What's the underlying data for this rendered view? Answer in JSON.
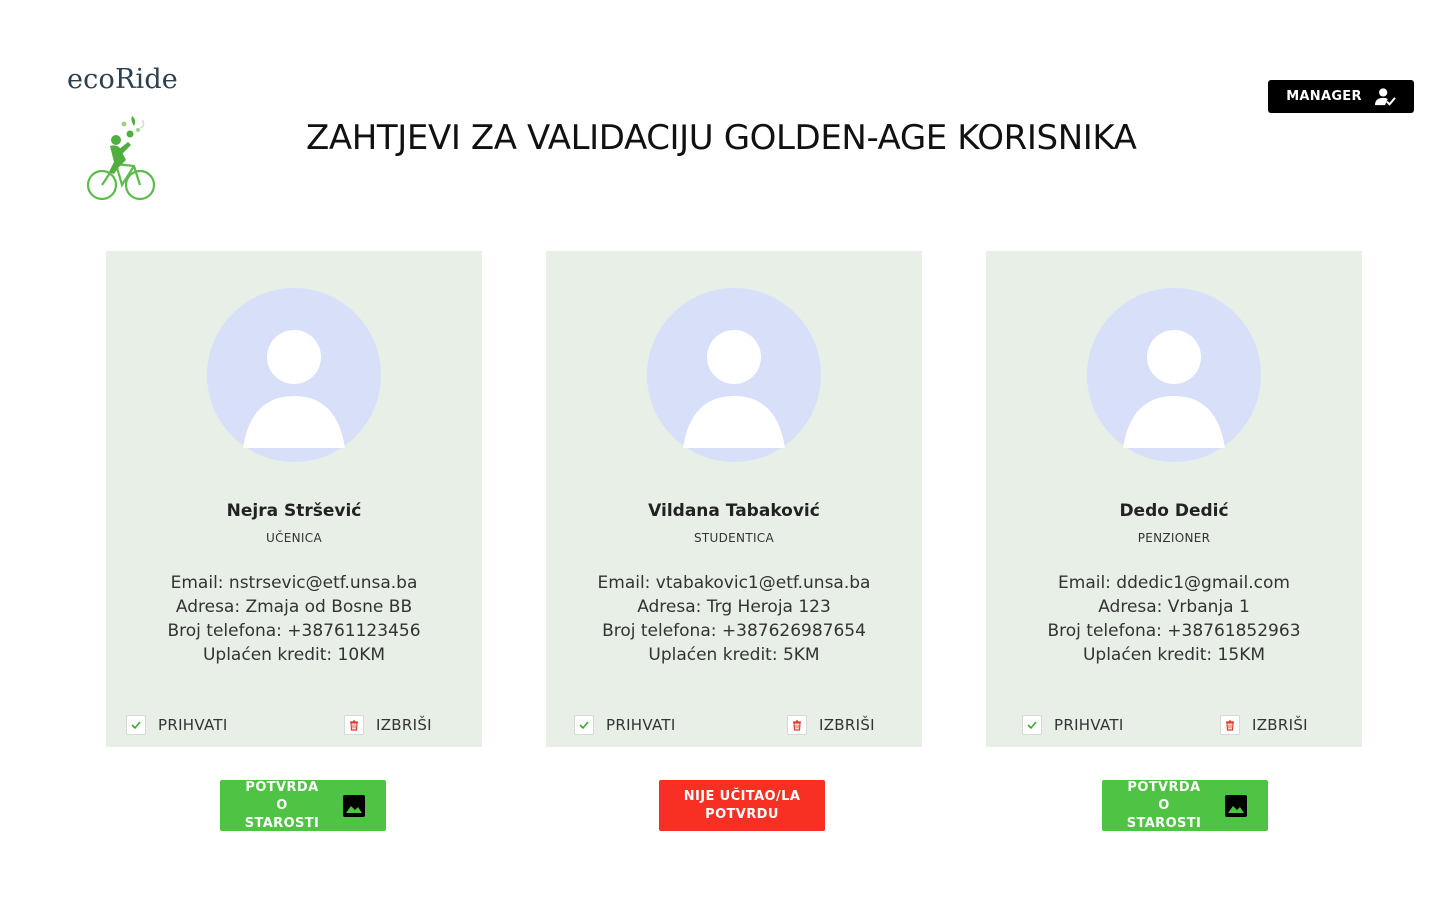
{
  "brand": {
    "name": "ecoRide",
    "logo_icon": "cyclist-icon"
  },
  "header": {
    "title": "ZAHTJEVI ZA VALIDACIJU GOLDEN-AGE KORISNIKA",
    "manager_label": "MANAGER",
    "manager_icon": "user-check-icon"
  },
  "colors": {
    "card_bg": "#e7efe7",
    "avatar_bg": "#d8dff9",
    "accept_green": "#4fc343",
    "reject_red": "#f73023",
    "delete_red": "#e23b2e"
  },
  "users": [
    {
      "name": "Nejra Stršević",
      "role": "UČENICA",
      "email": "Email: nstrsevic@etf.unsa.ba",
      "address": "Adresa: Zmaja od Bosne BB",
      "phone": "Broj telefona: +38761123456",
      "credit": "Uplaćen kredit: 10KM",
      "accept_label": "PRIHVATI",
      "delete_label": "IZBRIŠI",
      "proof_label": "POTVRDA O STAROSTI",
      "proof_status": "uploaded"
    },
    {
      "name": "Vildana Tabaković",
      "role": "STUDENTICA",
      "email": "Email: vtabakovic1@etf.unsa.ba",
      "address": "Adresa: Trg Heroja 123",
      "phone": "Broj telefona: +387626987654",
      "credit": "Uplaćen kredit: 5KM",
      "accept_label": "PRIHVATI",
      "delete_label": "IZBRIŠI",
      "proof_label": "NIJE UČITAO/LA POTVRDU",
      "proof_status": "missing"
    },
    {
      "name": "Dedo Dedić",
      "role": "PENZIONER",
      "email": "Email: ddedic1@gmail.com",
      "address": "Adresa: Vrbanja 1",
      "phone": "Broj telefona: +38761852963",
      "credit": "Uplaćen kredit: 15KM",
      "accept_label": "PRIHVATI",
      "delete_label": "IZBRIŠI",
      "proof_label": "POTVRDA O STAROSTI",
      "proof_status": "uploaded"
    }
  ]
}
